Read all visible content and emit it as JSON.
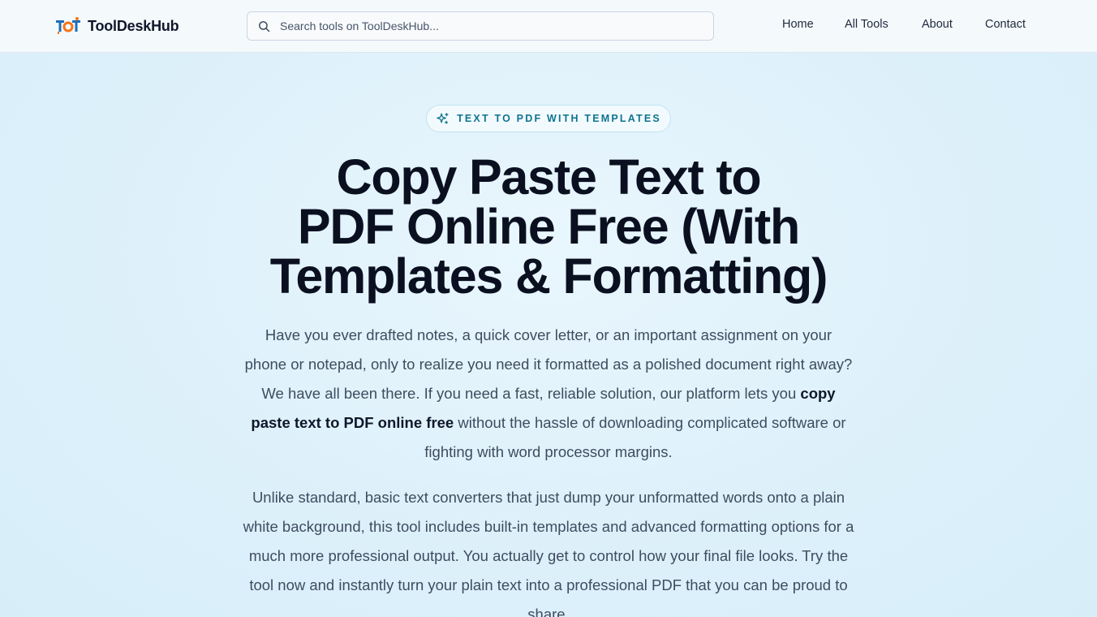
{
  "header": {
    "logo_text": "ToolDeskHub",
    "search_placeholder": "Search tools on ToolDeskHub...",
    "nav": [
      "Home",
      "All Tools",
      "About",
      "Contact"
    ]
  },
  "hero": {
    "badge": "TEXT TO PDF WITH TEMPLATES",
    "title_lines": [
      "Copy Paste Text to",
      "PDF Online Free (With",
      "Templates & Formatting)"
    ],
    "intro_before": "Have you ever drafted notes, a quick cover letter, or an important assignment on your phone or notepad, only to realize you need it formatted as a polished document right away? We have all been there. If you need a fast, reliable solution, our platform lets you ",
    "intro_bold": "copy paste text to PDF online free",
    "intro_after": " without the hassle of downloading complicated software or fighting with word processor margins.",
    "second_paragraph": "Unlike standard, basic text converters that just dump your unformatted words onto a plain white background, this tool includes built-in templates and advanced formatting options for a much more professional output. You actually get to control how your final file looks. Try the tool now and instantly turn your plain text into a professional PDF that you can be proud to share."
  },
  "colors": {
    "accent": "#0e7490",
    "logo_blue": "#1d6fb8",
    "logo_orange": "#f97316"
  }
}
